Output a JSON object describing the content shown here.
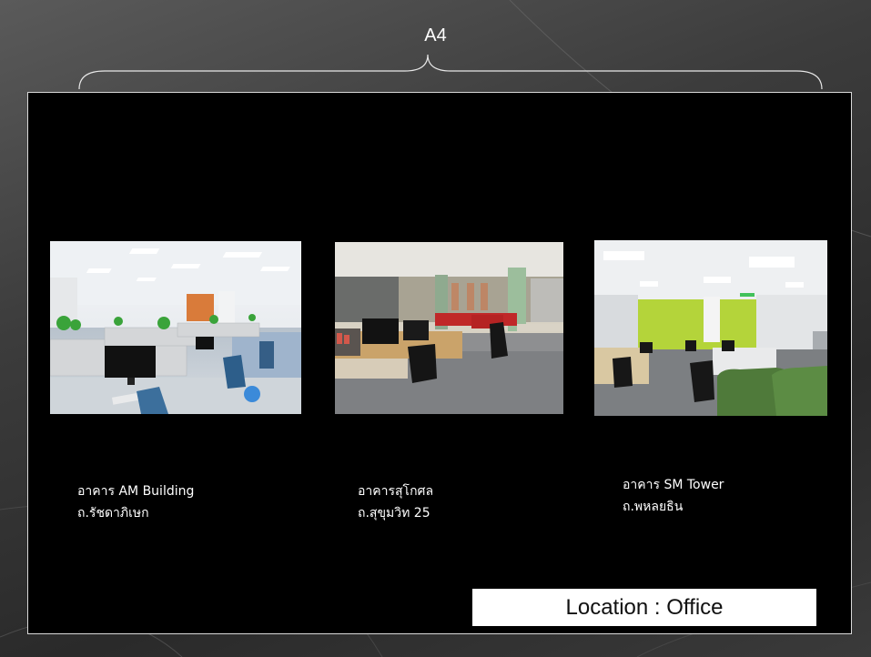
{
  "slide": {
    "title": "A4"
  },
  "offices": [
    {
      "building": "อาคาร AM Building",
      "road": "ถ.รัชดาภิเษก",
      "photo_icon": "office-photo-icon"
    },
    {
      "building": "อาคารสุโกศล",
      "road": "ถ.สุขุมวิท 25",
      "photo_icon": "office-photo-icon"
    },
    {
      "building": "อาคาร SM Tower",
      "road": "ถ.พหลยธิน",
      "photo_icon": "office-photo-icon"
    }
  ],
  "footer": {
    "location_label": "Location : Office"
  },
  "colors": {
    "panel": "#000000",
    "panel_border": "#d9d9d9",
    "text": "#ffffff",
    "label_box": "#ffffff"
  }
}
